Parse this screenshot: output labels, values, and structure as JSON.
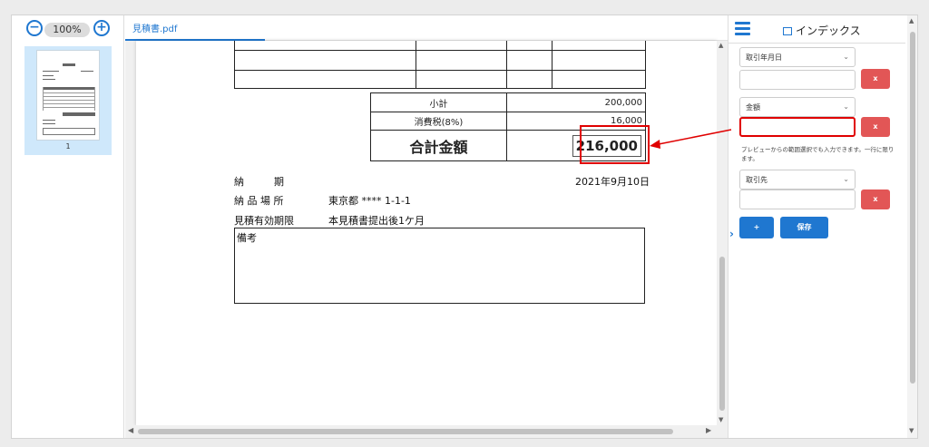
{
  "thumbnails": {
    "zoom_level": "100%",
    "zoom_out_symbol": "−",
    "zoom_in_symbol": "+",
    "pages": [
      {
        "number": "1"
      }
    ]
  },
  "viewer": {
    "tab_label": "見積書.pdf"
  },
  "document": {
    "totals": {
      "subtotal_label": "小計",
      "subtotal_value": "200,000",
      "tax_label": "消費税(8%)",
      "tax_value": "16,000",
      "total_label": "合計金額",
      "total_value": "216,000"
    },
    "details": {
      "delivery_date_label": "納　　　期",
      "delivery_date_value": "2021年9月10日",
      "delivery_place_label": "納 品 場 所",
      "delivery_place_value": "東京都 **** 1-1-1",
      "validity_label": "見積有効期限",
      "validity_value": "本見積書提出後1ケ月",
      "remarks_label": "備考"
    }
  },
  "index_panel": {
    "title": "インデックス",
    "fields": [
      {
        "select_label": "取引年月日",
        "input_value": "",
        "remove_label": "x"
      },
      {
        "select_label": "金額",
        "input_value": "",
        "remove_label": "x"
      },
      {
        "select_label": "取引先",
        "input_value": "",
        "remove_label": "x"
      }
    ],
    "hint": "プレビューからの範囲選択でも入力できます。一行に限ります。",
    "add_label": "+",
    "save_label": "保存"
  },
  "colors": {
    "accent": "#1f77d0",
    "danger": "#e25656",
    "highlight": "#e00000",
    "selection_bg": "#cfe8fb"
  }
}
